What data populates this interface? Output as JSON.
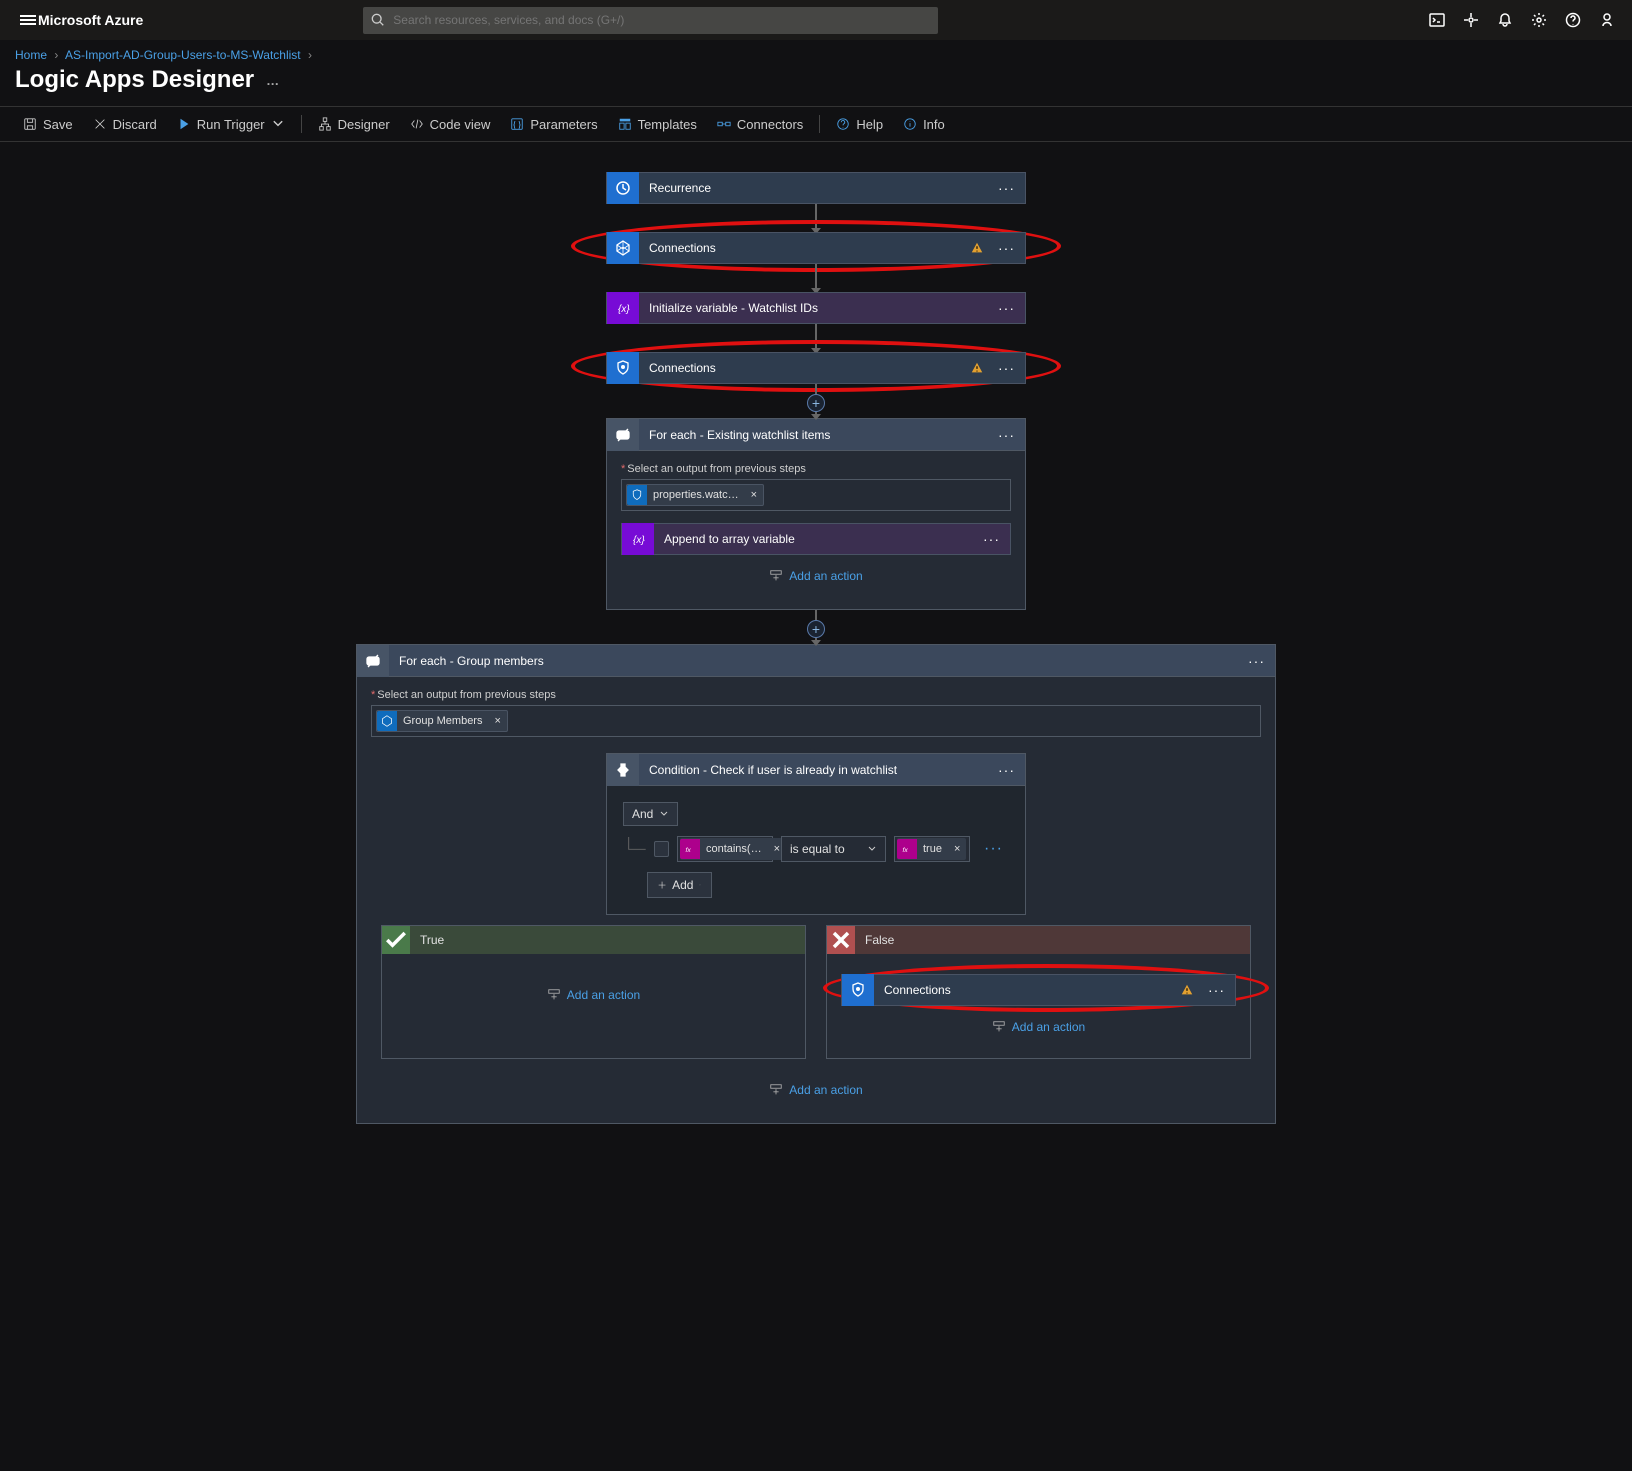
{
  "header": {
    "brand": "Microsoft Azure",
    "search_placeholder": "Search resources, services, and docs (G+/)"
  },
  "breadcrumb": {
    "home": "Home",
    "item": "AS-Import-AD-Group-Users-to-MS-Watchlist"
  },
  "page": {
    "title": "Logic Apps Designer",
    "extra": "…"
  },
  "toolbar": {
    "save": "Save",
    "discard": "Discard",
    "run": "Run Trigger",
    "designer": "Designer",
    "code": "Code view",
    "params": "Parameters",
    "templates": "Templates",
    "connectors": "Connectors",
    "help": "Help",
    "info": "Info"
  },
  "flow": {
    "recurrence": "Recurrence",
    "connections": "Connections",
    "init_var": "Initialize variable - Watchlist IDs",
    "foreach1_title": "For each - Existing watchlist items",
    "foreach1_label": "Select an output from previous steps",
    "foreach1_token": "properties.watc…",
    "foreach1_append": "Append to array variable",
    "foreach2_title": "For each - Group members",
    "foreach2_label": "Select an output from previous steps",
    "foreach2_token": "Group Members",
    "cond_title": "Condition - Check if user is already in watchlist",
    "cond_and": "And",
    "cond_left": "contains(…",
    "cond_op": "is equal to",
    "cond_right": "true",
    "cond_add": "Add",
    "true_label": "True",
    "false_label": "False",
    "addact": "Add an action"
  }
}
